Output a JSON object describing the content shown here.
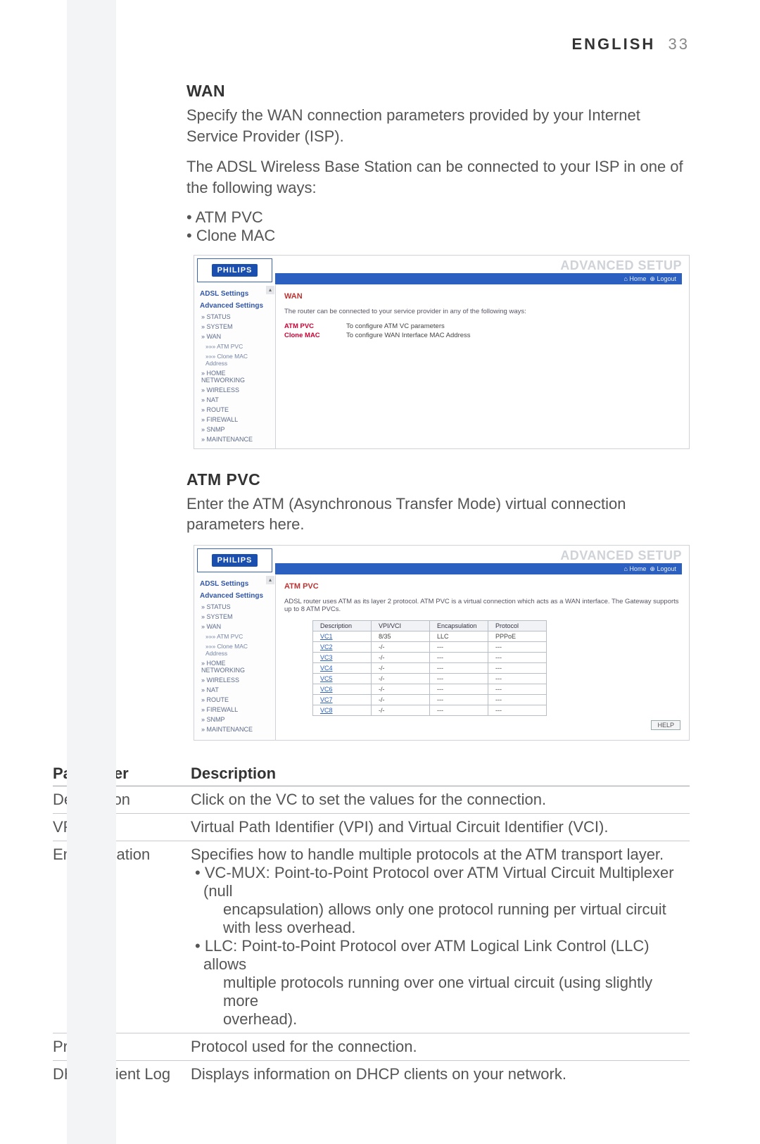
{
  "header": {
    "lang": "ENGLISH",
    "page_no": "33"
  },
  "wan": {
    "title": "WAN",
    "p1": "Specify the WAN connection parameters provided by your Internet Service Provider (ISP).",
    "p2": "The ADSL Wireless Base Station can be connected to your ISP in one of the following ways:",
    "bullets": [
      "ATM PVC",
      "Clone MAC"
    ]
  },
  "atm": {
    "title": "ATM PVC",
    "p1": "Enter the ATM (Asynchronous Transfer Mode) virtual connection parameters here."
  },
  "shot_common": {
    "logo": "PHILIPS",
    "advanced": "ADVANCED SETUP",
    "home": "Home",
    "logout": "Logout"
  },
  "nav1": {
    "h1": "ADSL Settings",
    "h2": "Advanced Settings",
    "items": [
      "» STATUS",
      "» SYSTEM",
      "» WAN",
      "»»» ATM PVC",
      "»»» Clone MAC Address",
      "» HOME NETWORKING",
      "» WIRELESS",
      "» NAT",
      "» ROUTE",
      "» FIREWALL",
      "» SNMP",
      "» MAINTENANCE"
    ]
  },
  "shot1": {
    "head": "WAN",
    "line": "The router can be connected to your service provider in any of the following ways:",
    "rows": [
      {
        "k": "ATM PVC",
        "v": "To configure ATM VC parameters"
      },
      {
        "k": "Clone MAC",
        "v": "To configure WAN Interface MAC Address"
      }
    ]
  },
  "shot2": {
    "head": "ATM PVC",
    "line": "ADSL router uses ATM as its layer 2 protocol. ATM PVC is a virtual connection which acts as a WAN interface. The Gateway supports up to 8 ATM PVCs.",
    "cols": [
      "Description",
      "VPI/VCI",
      "Encapsulation",
      "Protocol"
    ],
    "rows": [
      [
        "VC1",
        "8/35",
        "LLC",
        "PPPoE"
      ],
      [
        "VC2",
        "-/-",
        "---",
        "---"
      ],
      [
        "VC3",
        "-/-",
        "---",
        "---"
      ],
      [
        "VC4",
        "-/-",
        "---",
        "---"
      ],
      [
        "VC5",
        "-/-",
        "---",
        "---"
      ],
      [
        "VC6",
        "-/-",
        "---",
        "---"
      ],
      [
        "VC7",
        "-/-",
        "---",
        "---"
      ],
      [
        "VC8",
        "-/-",
        "---",
        "---"
      ]
    ],
    "help": "HELP"
  },
  "param_table": {
    "headers": [
      "Parameter",
      "Description"
    ],
    "rows": [
      {
        "p": "Description",
        "d": [
          "Click on the VC to set the values for the connection."
        ]
      },
      {
        "p": "VPI/VCI",
        "d": [
          "Virtual Path Identifier (VPI) and Virtual Circuit Identifier (VCI)."
        ]
      },
      {
        "p": "Encapsulation",
        "d": [
          "Specifies how to handle multiple protocols at the ATM transport layer.",
          "• VC-MUX: Point-to-Point Protocol over ATM Virtual Circuit Multiplexer (null",
          "    encapsulation) allows only one protocol running per virtual circuit",
          "    with less overhead.",
          "• LLC: Point-to-Point Protocol over ATM Logical Link Control (LLC) allows",
          "    multiple protocols running over one virtual circuit (using slightly more",
          "    overhead)."
        ]
      },
      {
        "p": "Protocol",
        "d": [
          "Protocol used for the connection."
        ]
      },
      {
        "p": "DHCP Client Log",
        "d": [
          "Displays information on DHCP clients on your network."
        ]
      }
    ]
  }
}
